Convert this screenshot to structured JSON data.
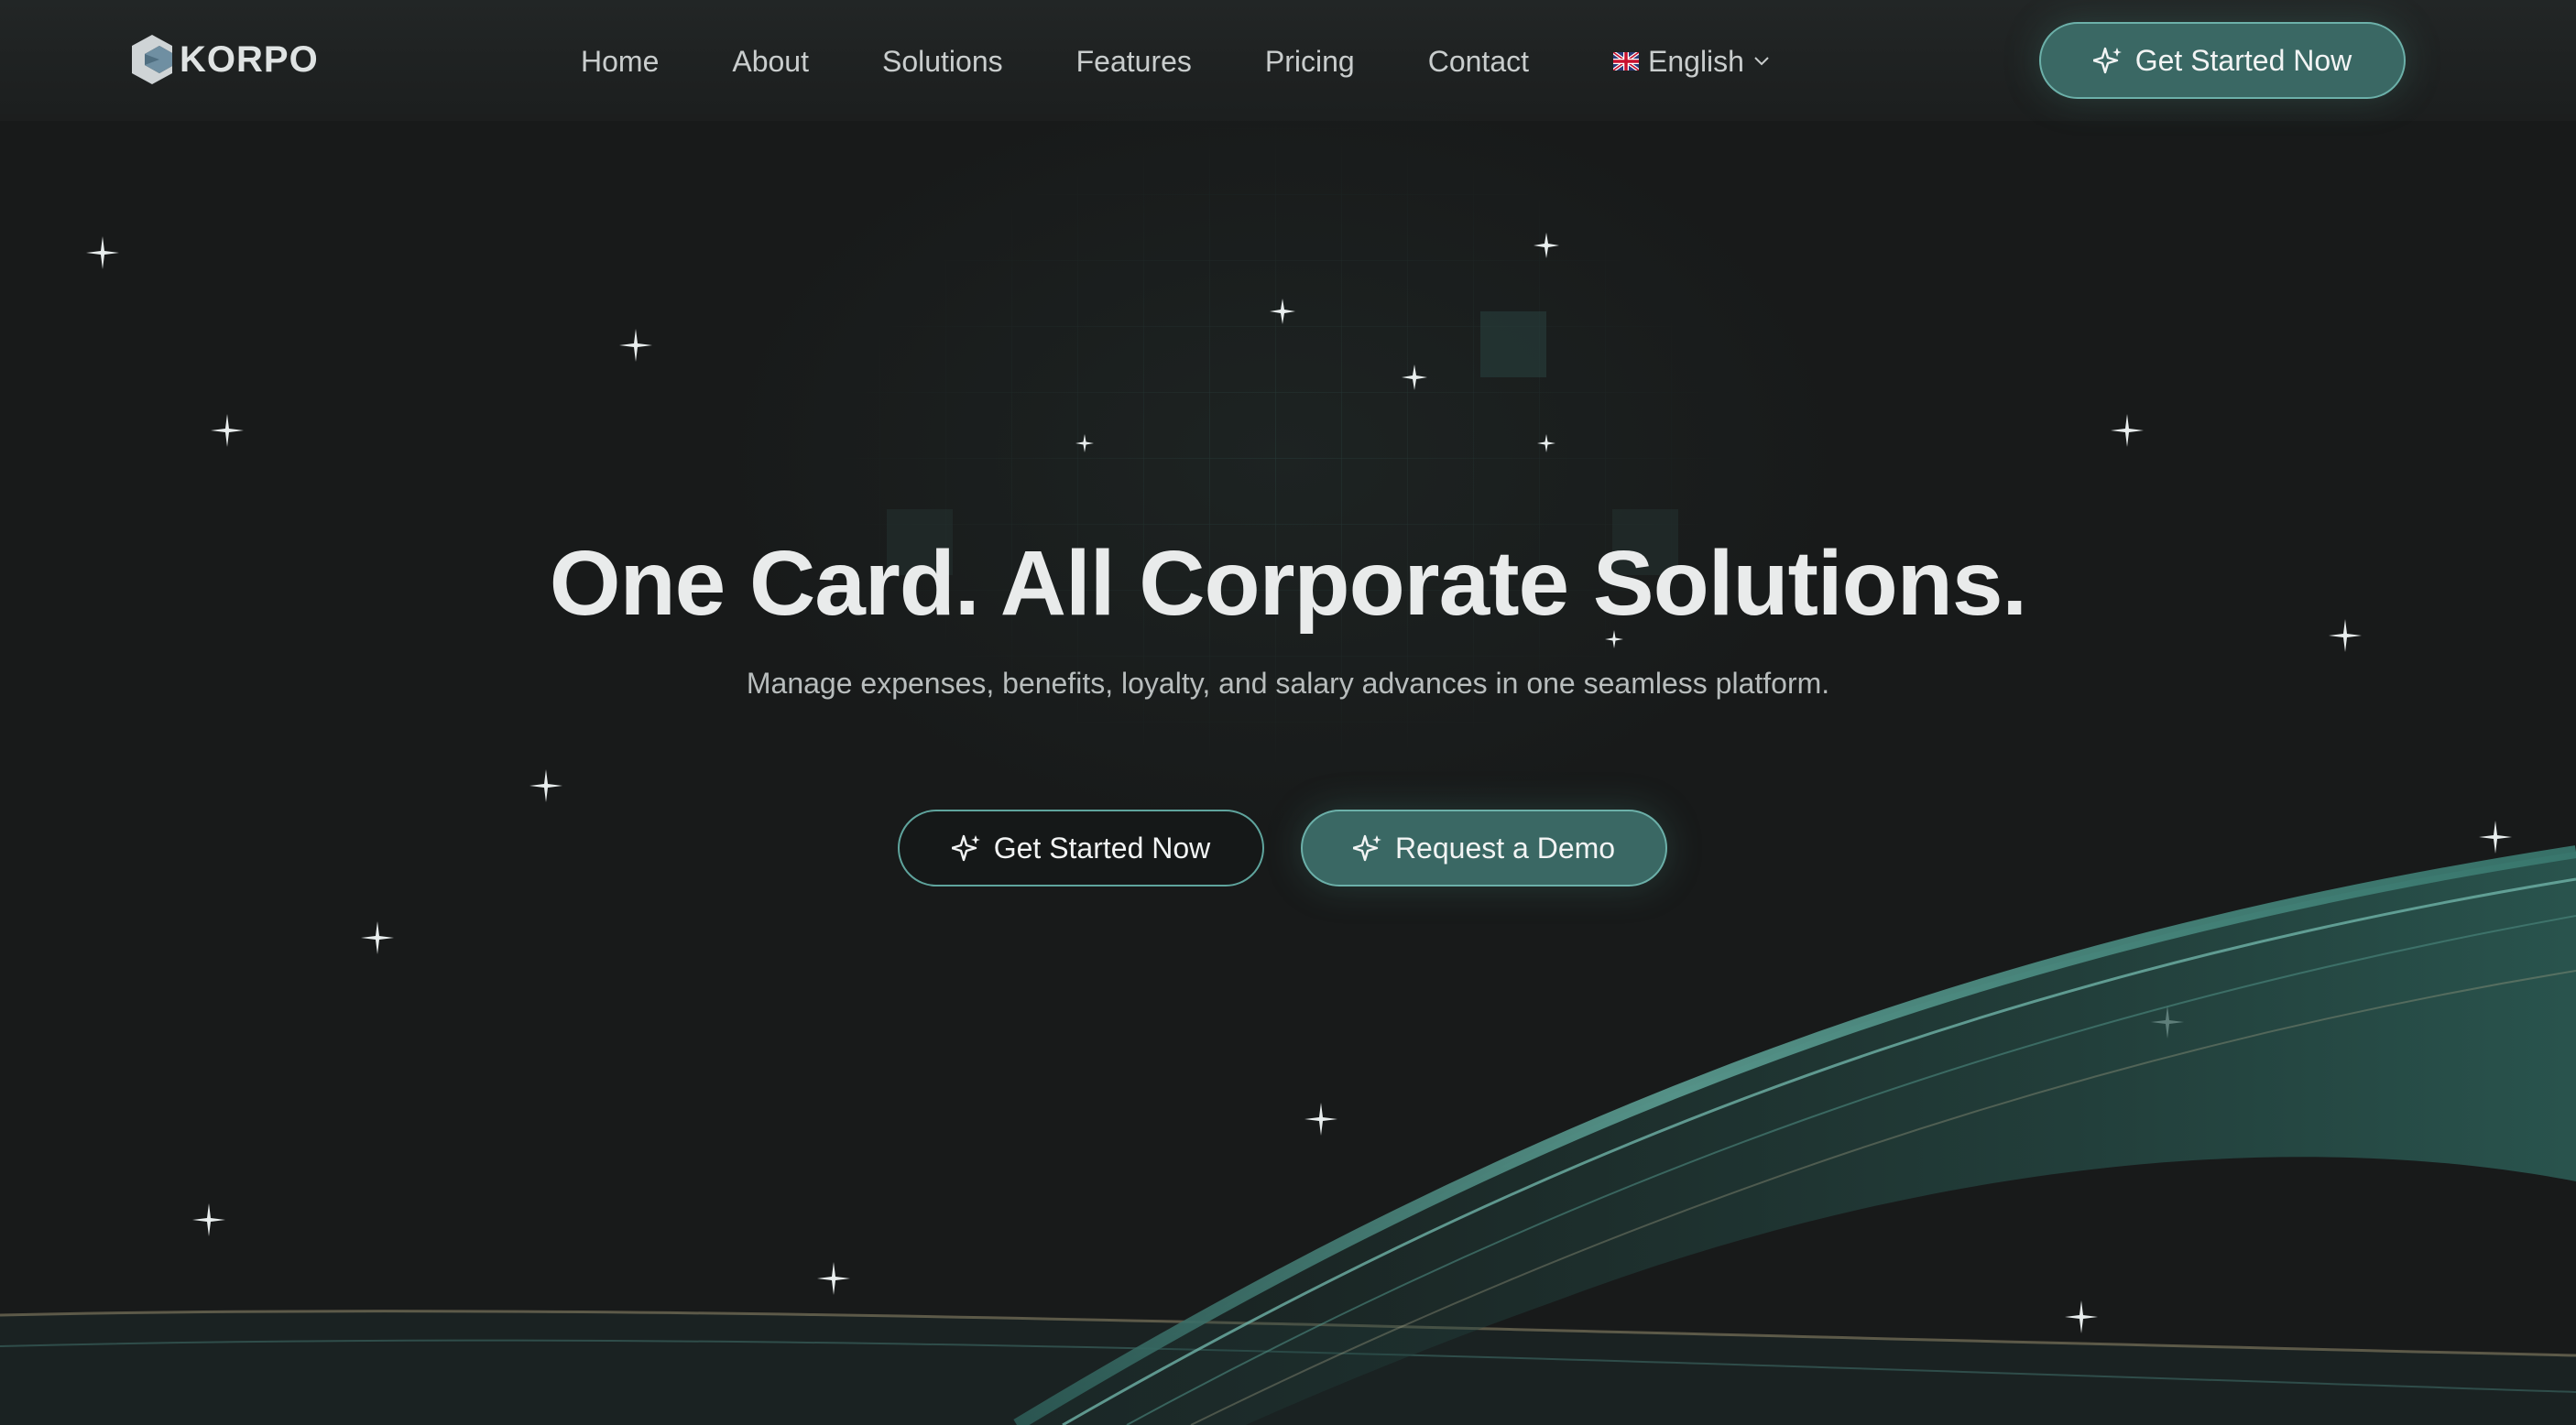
{
  "brand": {
    "name": "KORPO",
    "logo_icon": "korpo-logo-mark"
  },
  "nav": {
    "items": [
      {
        "label": "Home"
      },
      {
        "label": "About"
      },
      {
        "label": "Solutions"
      },
      {
        "label": "Features"
      },
      {
        "label": "Pricing"
      },
      {
        "label": "Contact"
      }
    ],
    "language": {
      "label": "English",
      "flag_icon": "uk-flag-icon",
      "caret_icon": "chevron-down-icon"
    }
  },
  "header_cta": {
    "label": "Get Started Now",
    "icon": "sparkle-icon"
  },
  "hero": {
    "title": "One Card. All Corporate Solutions.",
    "subtitle": "Manage expenses, benefits, loyalty, and salary advances in one seamless platform.",
    "primary_cta": {
      "label": "Get Started Now",
      "icon": "sparkle-icon"
    },
    "secondary_cta": {
      "label": "Request a Demo",
      "icon": "sparkle-icon"
    }
  },
  "colors": {
    "background": "#181a1a",
    "accent": "#3a6864",
    "accent_border": "#6cb0a9",
    "text": "#e9ebeb",
    "muted_text": "#b8bdbd"
  }
}
